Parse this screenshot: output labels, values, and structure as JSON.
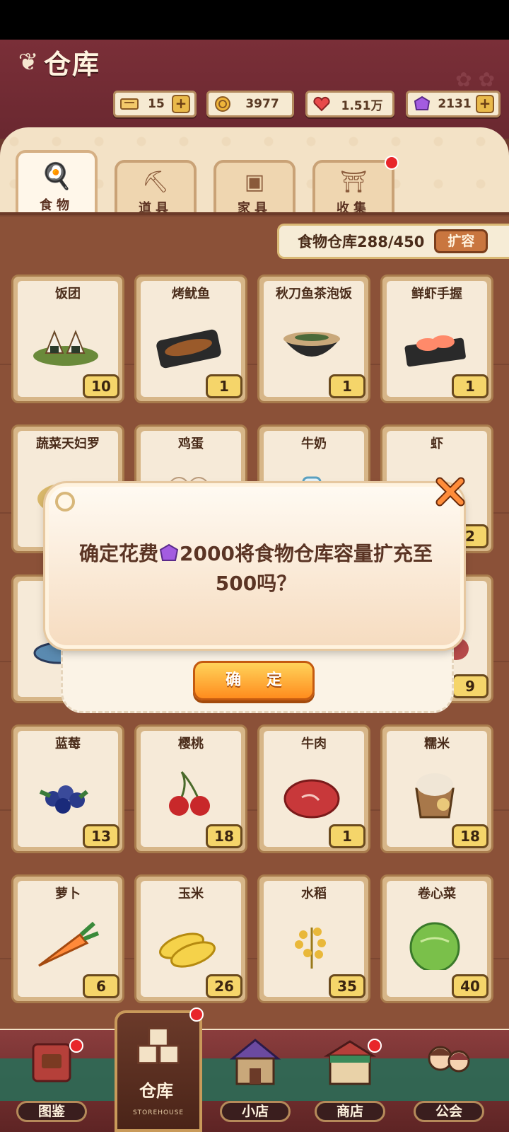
{
  "header": {
    "title": "仓库",
    "resources": [
      {
        "icon": "ticket-icon",
        "value": "15",
        "plus": "+"
      },
      {
        "icon": "coin-icon",
        "value": "3977"
      },
      {
        "icon": "heart-icon",
        "value": "1.51万"
      },
      {
        "icon": "gem-icon",
        "value": "2131",
        "plus": "+"
      }
    ]
  },
  "tabs": [
    {
      "label": "食物",
      "icon": "fried-egg-icon",
      "active": true
    },
    {
      "label": "道具",
      "icon": "shovel-icon"
    },
    {
      "label": "家具",
      "icon": "cabinet-icon"
    },
    {
      "label": "收集",
      "icon": "torii-gate-icon",
      "badge": true
    }
  ],
  "capacity": {
    "label": "食物仓库288/450",
    "button": "扩容"
  },
  "items": [
    {
      "name": "饭团",
      "count": "10",
      "art": "onigiri"
    },
    {
      "name": "烤鱿鱼",
      "count": "1",
      "art": "grilled-squid"
    },
    {
      "name": "秋刀鱼茶泡饭",
      "count": "1",
      "art": "ochazuke"
    },
    {
      "name": "鲜虾手握",
      "count": "1",
      "art": "shrimp-sushi"
    },
    {
      "name": "蔬菜天妇罗",
      "count": "",
      "art": "tempura"
    },
    {
      "name": "鸡蛋",
      "count": "",
      "art": "egg"
    },
    {
      "name": "牛奶",
      "count": "",
      "art": "milk"
    },
    {
      "name": "虾",
      "count": "2",
      "art": "shrimp"
    },
    {
      "name": "",
      "count": "",
      "art": "fish"
    },
    {
      "name": "",
      "count": "",
      "art": "hidden"
    },
    {
      "name": "",
      "count": "",
      "art": "hidden"
    },
    {
      "name": "",
      "count": "9",
      "art": "meat-red"
    },
    {
      "name": "蓝莓",
      "count": "13",
      "art": "blueberry"
    },
    {
      "name": "樱桃",
      "count": "18",
      "art": "cherry"
    },
    {
      "name": "牛肉",
      "count": "1",
      "art": "beef"
    },
    {
      "name": "糯米",
      "count": "18",
      "art": "rice-sack"
    },
    {
      "name": "萝卜",
      "count": "6",
      "art": "carrot"
    },
    {
      "name": "玉米",
      "count": "26",
      "art": "corn"
    },
    {
      "name": "水稻",
      "count": "35",
      "art": "rice-plant"
    },
    {
      "name": "卷心菜",
      "count": "40",
      "art": "cabbage"
    }
  ],
  "dialog": {
    "text_before": "确定花费",
    "text_after": "2000将食物仓库容量扩充至500吗？",
    "confirm": "确 定",
    "close_icon": "close-x-icon"
  },
  "nav": [
    {
      "label": "图鉴",
      "icon": "album-icon",
      "badge": true
    },
    {
      "label": "仓库",
      "sub": "STOREHOUSE",
      "icon": "crates-icon",
      "active": true,
      "badge": true
    },
    {
      "label": "小店",
      "icon": "shop-building-icon"
    },
    {
      "label": "商店",
      "icon": "store-building-icon",
      "badge": true
    },
    {
      "label": "公会",
      "icon": "guild-couple-icon"
    }
  ],
  "colors": {
    "accent": "#ff8c1e",
    "gem": "#a35ce0",
    "badge": "#e8262a",
    "wood": "#8b5138"
  }
}
